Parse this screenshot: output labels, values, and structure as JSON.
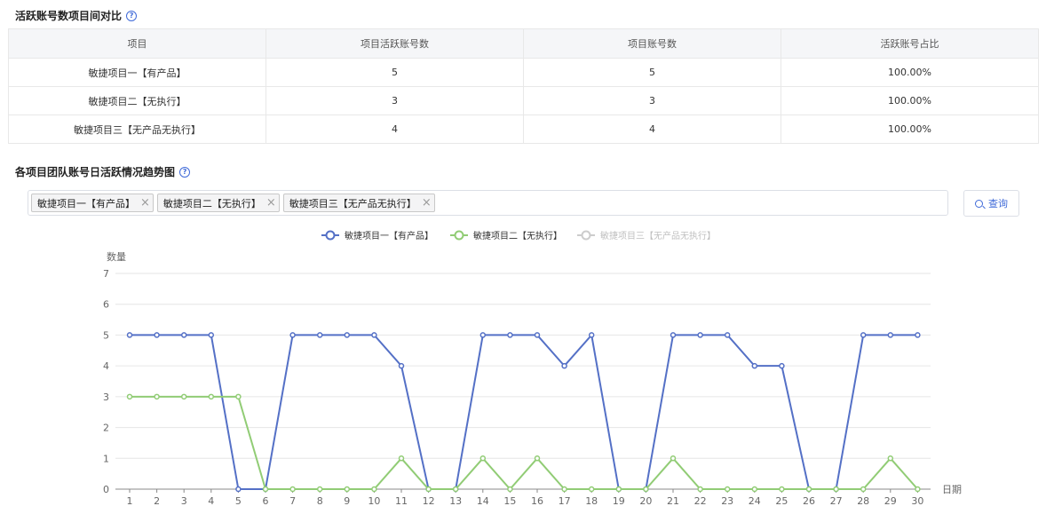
{
  "section1": {
    "title": "活跃账号数项目间对比",
    "help_icon": "?"
  },
  "table": {
    "headers": [
      "项目",
      "项目活跃账号数",
      "项目账号数",
      "活跃账号占比"
    ],
    "rows": [
      [
        "敏捷项目一【有产品】",
        "5",
        "5",
        "100.00%"
      ],
      [
        "敏捷项目二【无执行】",
        "3",
        "3",
        "100.00%"
      ],
      [
        "敏捷项目三【无产品无执行】",
        "4",
        "4",
        "100.00%"
      ]
    ]
  },
  "section2": {
    "title": "各项目团队账号日活跃情况趋势图",
    "help_icon": "?"
  },
  "selector": {
    "tags": [
      "敏捷项目一【有产品】",
      "敏捷项目二【无执行】",
      "敏捷项目三【无产品无执行】"
    ],
    "close_glyph": "×"
  },
  "query_button": {
    "label": "查询"
  },
  "colors": {
    "series1": "#5470c6",
    "series2": "#91cc75",
    "series3_disabled": "#cccccc",
    "accent": "#3f6ad8"
  },
  "chart_data": {
    "type": "line",
    "ylabel": "数量",
    "xlabel": "日期",
    "ylim": [
      0,
      7
    ],
    "yticks": [
      0,
      1,
      2,
      3,
      4,
      5,
      6,
      7
    ],
    "x": [
      1,
      2,
      3,
      4,
      5,
      6,
      7,
      8,
      9,
      10,
      11,
      12,
      13,
      14,
      15,
      16,
      17,
      18,
      19,
      20,
      21,
      22,
      23,
      24,
      25,
      26,
      27,
      28,
      29,
      30
    ],
    "legend_position": "top-center",
    "grid": true,
    "series": [
      {
        "name": "敏捷项目一【有产品】",
        "color": "#5470c6",
        "enabled": true,
        "values": [
          5,
          5,
          5,
          5,
          0,
          0,
          5,
          5,
          5,
          5,
          4,
          0,
          0,
          5,
          5,
          5,
          4,
          5,
          0,
          0,
          5,
          5,
          5,
          4,
          4,
          0,
          0,
          5,
          5,
          5
        ]
      },
      {
        "name": "敏捷项目二【无执行】",
        "color": "#91cc75",
        "enabled": true,
        "values": [
          3,
          3,
          3,
          3,
          3,
          0,
          0,
          0,
          0,
          0,
          1,
          0,
          0,
          1,
          0,
          1,
          0,
          0,
          0,
          0,
          1,
          0,
          0,
          0,
          0,
          0,
          0,
          0,
          1,
          0
        ]
      },
      {
        "name": "敏捷项目三【无产品无执行】",
        "color": "#cccccc",
        "enabled": false,
        "values": []
      }
    ]
  }
}
